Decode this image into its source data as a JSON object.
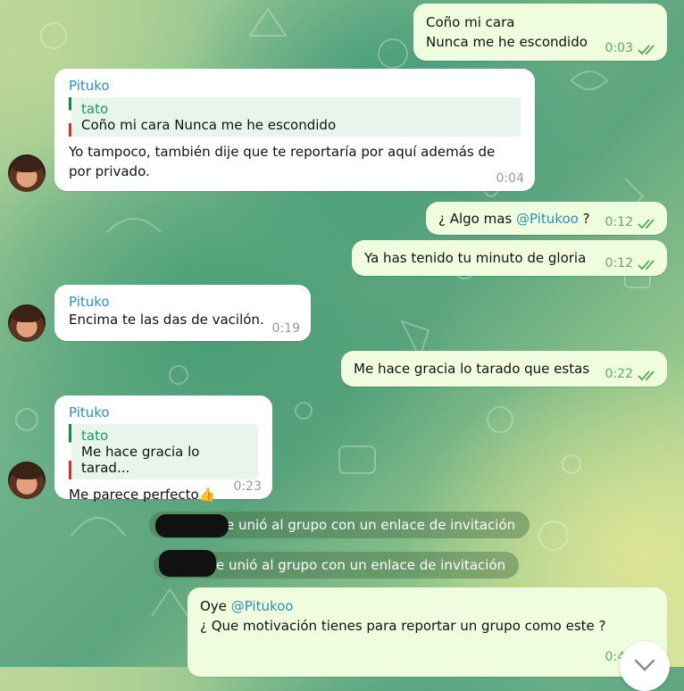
{
  "messages": [
    {
      "dir": "out",
      "lines": "Coño mi cara\nNunca me he escondido",
      "time": "0:03"
    },
    {
      "dir": "in",
      "sender": "Pituko",
      "reply": {
        "name": "tato",
        "text": "Coño mi cara Nunca me he escondido"
      },
      "lines": "Yo tampoco, también dije que te reportaría por aquí además de\npor privado.",
      "time": "0:04"
    },
    {
      "dir": "out",
      "pre": "¿ Algo mas ",
      "mention": "@Pitukoo",
      "post": " ?",
      "time": "0:12"
    },
    {
      "dir": "out",
      "lines": "Ya has tenido tu minuto de gloria",
      "time": "0:12"
    },
    {
      "dir": "in",
      "sender": "Pituko",
      "lines": "Encima te las das de vacilón.",
      "time": "0:19"
    },
    {
      "dir": "out",
      "lines": "Me hace gracia lo tarado que estas",
      "time": "0:22"
    },
    {
      "dir": "in",
      "sender": "Pituko",
      "reply": {
        "name": "tato",
        "text": "Me hace gracia lo tarad..."
      },
      "lines": "Me parece perfecto👍",
      "time": "0:23"
    },
    {
      "dir": "out",
      "pre": "Oye ",
      "mention": "@Pitukoo",
      "line2": "¿ Que motivación tienes para reportar un grupo como este ?",
      "time": "0:41"
    }
  ],
  "service": [
    {
      "text": "e unió al grupo con un enlace de invitación"
    },
    {
      "text": "e unió al grupo con un enlace de invitación"
    }
  ],
  "colors": {
    "accent": "#2f8fb5",
    "out_bubble": "#effdde",
    "check": "#5fad5e"
  },
  "icons": {
    "read": "double-check-icon",
    "scroll": "chevron-down-icon"
  }
}
